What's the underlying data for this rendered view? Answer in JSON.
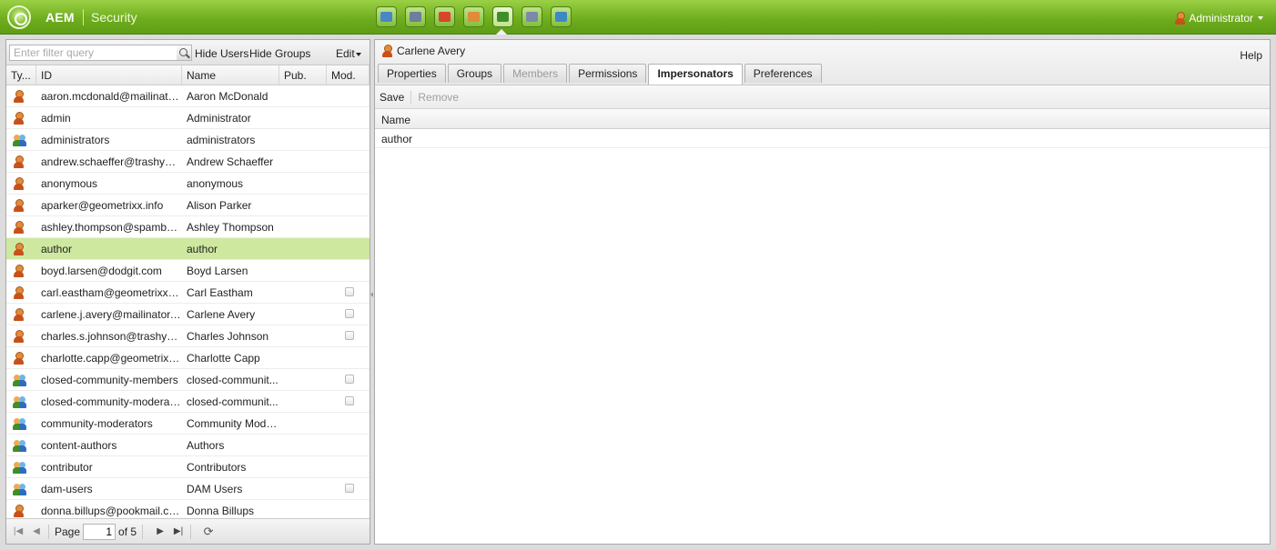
{
  "topbar": {
    "brand": "AEM",
    "console": "Security",
    "nav_icons": [
      {
        "icon": "globe-websites-icon",
        "color": "#4a86c7"
      },
      {
        "icon": "dam-binoculars-icon",
        "color": "#6d7f99"
      },
      {
        "icon": "campaigns-megaphone-icon",
        "color": "#d9452b"
      },
      {
        "icon": "inbox-envelope-icon",
        "color": "#e08a3a"
      },
      {
        "icon": "users-security-icon",
        "color": "#3f8e2a"
      },
      {
        "icon": "tools-gears-icon",
        "color": "#7a8aa8"
      },
      {
        "icon": "tagging-tag-icon",
        "color": "#3d88c7"
      }
    ],
    "user": "Administrator"
  },
  "left": {
    "filter_placeholder": "Enter filter query",
    "hide_users": "Hide Users",
    "hide_groups": "Hide Groups",
    "edit": "Edit",
    "columns": {
      "type": "Ty...",
      "id": "ID",
      "name": "Name",
      "pub": "Pub.",
      "mod": "Mod."
    },
    "rows": [
      {
        "type": "user",
        "id": "aaron.mcdonald@mailinator....",
        "name": "Aaron McDonald",
        "mod": false
      },
      {
        "type": "user",
        "id": "admin",
        "name": "Administrator",
        "mod": false
      },
      {
        "type": "group",
        "id": "administrators",
        "name": "administrators",
        "mod": false
      },
      {
        "type": "user",
        "id": "andrew.schaeffer@trashyma...",
        "name": "Andrew Schaeffer",
        "mod": false
      },
      {
        "type": "user",
        "id": "anonymous",
        "name": "anonymous",
        "mod": false
      },
      {
        "type": "user",
        "id": "aparker@geometrixx.info",
        "name": "Alison Parker",
        "mod": false
      },
      {
        "type": "user",
        "id": "ashley.thompson@spambob....",
        "name": "Ashley Thompson",
        "mod": false
      },
      {
        "type": "user",
        "id": "author",
        "name": "author",
        "mod": false,
        "selected": true
      },
      {
        "type": "user",
        "id": "boyd.larsen@dodgit.com",
        "name": "Boyd Larsen",
        "mod": false
      },
      {
        "type": "user",
        "id": "carl.eastham@geometrixx-m...",
        "name": "Carl Eastham",
        "mod": true
      },
      {
        "type": "user",
        "id": "carlene.j.avery@mailinator.c...",
        "name": "Carlene Avery",
        "mod": true
      },
      {
        "type": "user",
        "id": "charles.s.johnson@trashyma...",
        "name": "Charles Johnson",
        "mod": true
      },
      {
        "type": "user",
        "id": "charlotte.capp@geometrixx-...",
        "name": "Charlotte Capp",
        "mod": false
      },
      {
        "type": "group",
        "id": "closed-community-members",
        "name": "closed-communit...",
        "mod": true
      },
      {
        "type": "group",
        "id": "closed-community-moderators",
        "name": "closed-communit...",
        "mod": true
      },
      {
        "type": "group",
        "id": "community-moderators",
        "name": "Community Mode...",
        "mod": false
      },
      {
        "type": "group",
        "id": "content-authors",
        "name": "Authors",
        "mod": false
      },
      {
        "type": "group",
        "id": "contributor",
        "name": "Contributors",
        "mod": false
      },
      {
        "type": "group",
        "id": "dam-users",
        "name": "DAM Users",
        "mod": true
      },
      {
        "type": "user",
        "id": "donna.billups@pookmail.com",
        "name": "Donna Billups",
        "mod": false
      }
    ],
    "pager": {
      "page_label": "Page",
      "page_value": "1",
      "of_label": "of 5"
    }
  },
  "right": {
    "title": "Carlene Avery",
    "help": "Help",
    "tabs": [
      {
        "label": "Properties",
        "state": "normal"
      },
      {
        "label": "Groups",
        "state": "normal"
      },
      {
        "label": "Members",
        "state": "disabled"
      },
      {
        "label": "Permissions",
        "state": "normal"
      },
      {
        "label": "Impersonators",
        "state": "active"
      },
      {
        "label": "Preferences",
        "state": "normal"
      }
    ],
    "save": "Save",
    "remove": "Remove",
    "column": "Name",
    "rows": [
      "author"
    ]
  }
}
